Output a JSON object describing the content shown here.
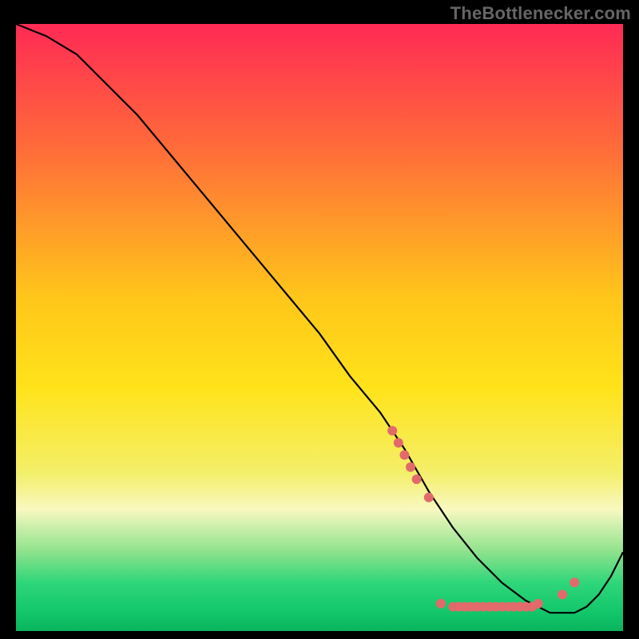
{
  "watermark": {
    "text": "TheBottlenecker.com"
  },
  "chart_data": {
    "type": "line",
    "title": "",
    "xlabel": "",
    "ylabel": "",
    "xlim": [
      0,
      100
    ],
    "ylim": [
      0,
      100
    ],
    "background_gradient_stops": [
      {
        "offset": 0.0,
        "color": "#ff2a55"
      },
      {
        "offset": 0.2,
        "color": "#ff6a3a"
      },
      {
        "offset": 0.45,
        "color": "#ffc61a"
      },
      {
        "offset": 0.6,
        "color": "#ffe31a"
      },
      {
        "offset": 0.74,
        "color": "#f4ef6a"
      },
      {
        "offset": 0.8,
        "color": "#f8f8c0"
      },
      {
        "offset": 0.87,
        "color": "#8ce28c"
      },
      {
        "offset": 0.92,
        "color": "#2fd67a"
      },
      {
        "offset": 0.97,
        "color": "#12c66a"
      },
      {
        "offset": 1.0,
        "color": "#0ab45e"
      }
    ],
    "series": [
      {
        "name": "curve",
        "x": [
          0,
          5,
          10,
          15,
          20,
          25,
          30,
          35,
          40,
          45,
          50,
          55,
          60,
          62,
          64,
          68,
          72,
          76,
          80,
          84,
          88,
          90,
          92,
          94,
          96,
          98,
          100
        ],
        "y": [
          100,
          98,
          95,
          90,
          85,
          79,
          73,
          67,
          61,
          55,
          49,
          42,
          36,
          33,
          30,
          23,
          17,
          12,
          8,
          5,
          3,
          3,
          3,
          4,
          6,
          9,
          13
        ]
      }
    ],
    "markers": {
      "name": "dots",
      "color": "#e26a6a",
      "radius": 6,
      "points": [
        {
          "x": 62,
          "y": 33
        },
        {
          "x": 63,
          "y": 31
        },
        {
          "x": 64,
          "y": 29
        },
        {
          "x": 65,
          "y": 27
        },
        {
          "x": 66,
          "y": 25
        },
        {
          "x": 68,
          "y": 22
        },
        {
          "x": 70,
          "y": 4.5
        },
        {
          "x": 72,
          "y": 4
        },
        {
          "x": 73,
          "y": 4
        },
        {
          "x": 74,
          "y": 4
        },
        {
          "x": 75,
          "y": 4
        },
        {
          "x": 76,
          "y": 4
        },
        {
          "x": 77,
          "y": 4
        },
        {
          "x": 78,
          "y": 4
        },
        {
          "x": 79,
          "y": 4
        },
        {
          "x": 80,
          "y": 4
        },
        {
          "x": 81,
          "y": 4
        },
        {
          "x": 82,
          "y": 4
        },
        {
          "x": 83,
          "y": 4
        },
        {
          "x": 84,
          "y": 4
        },
        {
          "x": 85,
          "y": 4
        },
        {
          "x": 86,
          "y": 4.5
        },
        {
          "x": 90,
          "y": 6
        },
        {
          "x": 92,
          "y": 8
        }
      ]
    }
  }
}
